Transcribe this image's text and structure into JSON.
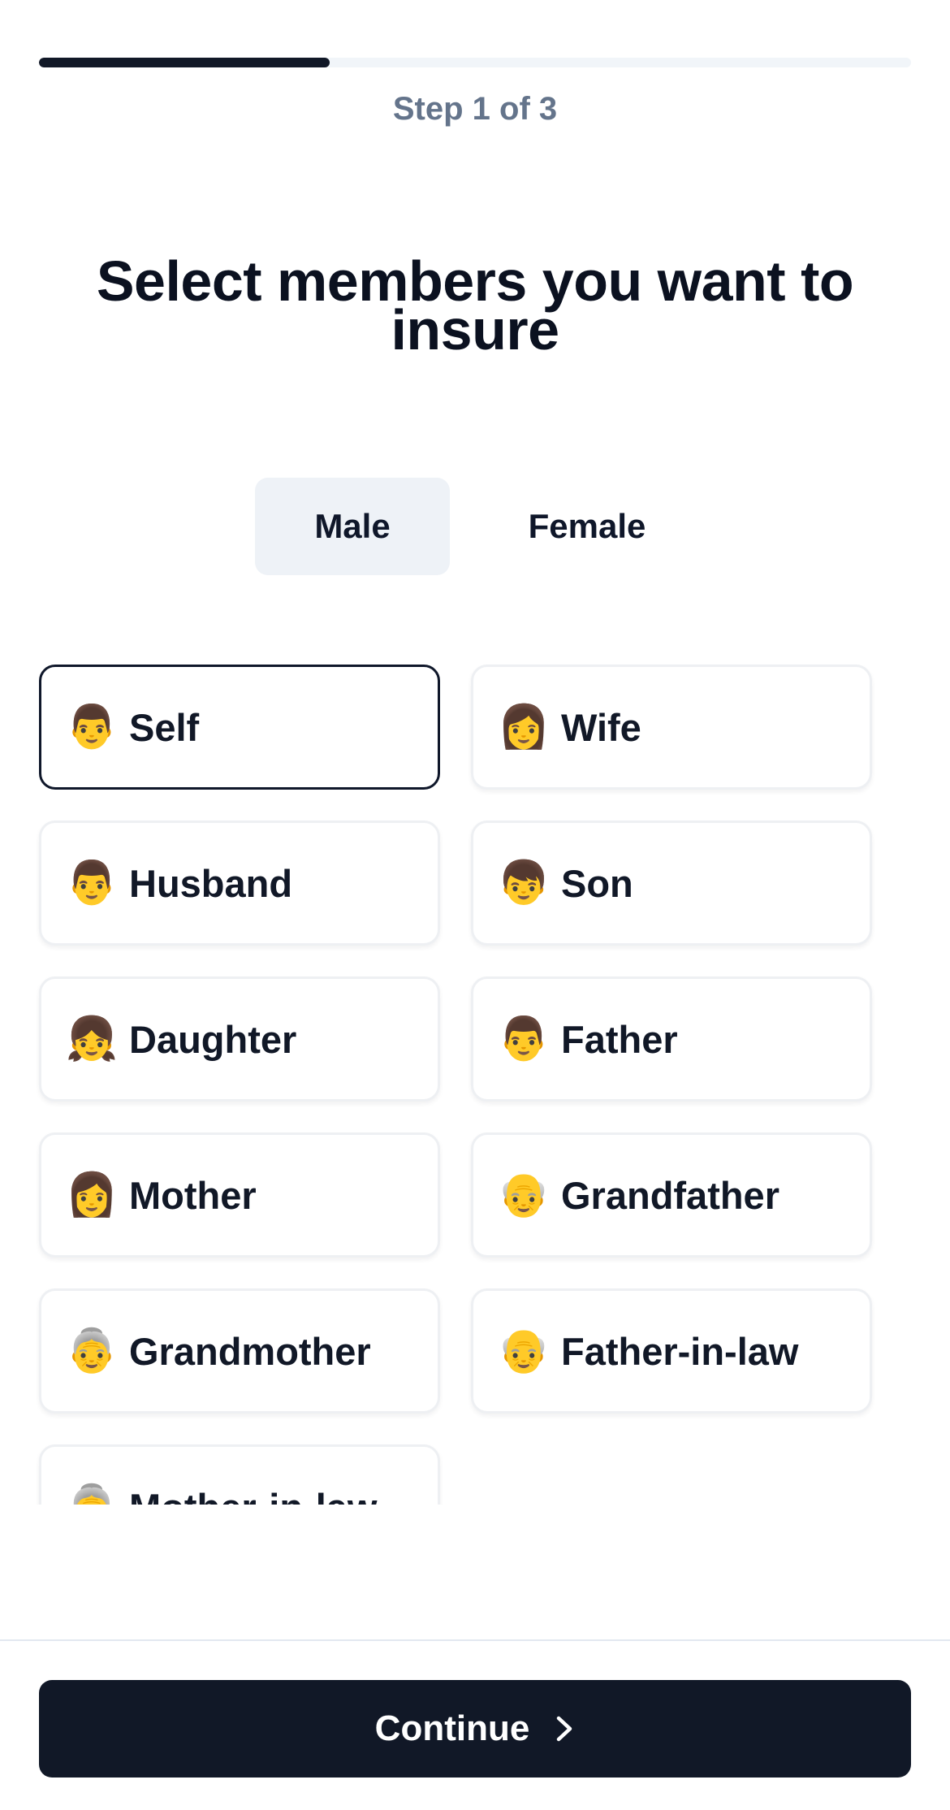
{
  "progress": {
    "step_text": "Step 1 of 3",
    "fraction": 0.333
  },
  "title": {
    "line1": "Select members you want to",
    "line2": "insure"
  },
  "gender_toggle": {
    "male_label": "Male",
    "female_label": "Female",
    "selected": "Male"
  },
  "members": [
    {
      "label": "Self",
      "icon": "man-icon",
      "glyph": "👨",
      "selected": true
    },
    {
      "label": "Wife",
      "icon": "woman-icon",
      "glyph": "👩",
      "selected": false
    },
    {
      "label": "Husband",
      "icon": "man-icon",
      "glyph": "👨",
      "selected": false
    },
    {
      "label": "Son",
      "icon": "boy-icon",
      "glyph": "👦",
      "selected": false
    },
    {
      "label": "Daughter",
      "icon": "girl-icon",
      "glyph": "👧",
      "selected": false
    },
    {
      "label": "Father",
      "icon": "man-icon",
      "glyph": "👨",
      "selected": false
    },
    {
      "label": "Mother",
      "icon": "woman-icon",
      "glyph": "👩",
      "selected": false
    },
    {
      "label": "Grandfather",
      "icon": "old-man-icon",
      "glyph": "👴",
      "selected": false
    },
    {
      "label": "Grandmother",
      "icon": "old-woman-icon",
      "glyph": "👵",
      "selected": false
    },
    {
      "label": "Father-in-law",
      "icon": "old-man-icon",
      "glyph": "👴",
      "selected": false
    },
    {
      "label": "Mother-in-law",
      "icon": "old-woman-icon",
      "glyph": "👵",
      "selected": false
    }
  ],
  "continue_button": {
    "label": "Continue",
    "icon": "chevron-right-icon"
  },
  "colors": {
    "primary": "#111827",
    "muted_text": "#64748b",
    "toggle_bg": "#eef2f7",
    "skin": "#f5b731"
  }
}
